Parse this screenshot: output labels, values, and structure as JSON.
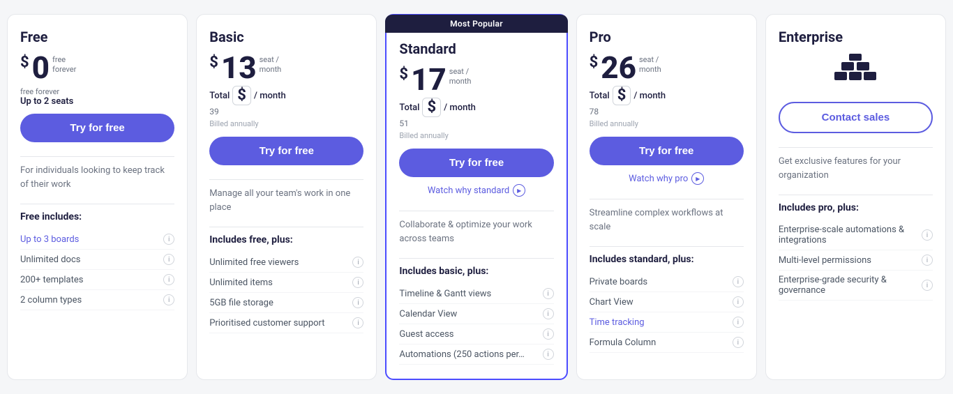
{
  "plans": [
    {
      "id": "free",
      "name": "Free",
      "featured": false,
      "price": "0",
      "price_sublabel1": "free",
      "price_sublabel2": "forever",
      "seats_label": "Up to 2 seats",
      "total_label": null,
      "total_amount": null,
      "billed_label": null,
      "cta_label": "Try for free",
      "cta_style": "primary",
      "watch_label": null,
      "description": "For individuals looking to keep track of their work",
      "includes_title": "Free includes:",
      "features": [
        {
          "text": "Up to 3 boards",
          "link": true
        },
        {
          "text": "Unlimited docs",
          "link": false
        },
        {
          "text": "200+ templates",
          "link": false
        },
        {
          "text": "2 column types",
          "link": false
        }
      ]
    },
    {
      "id": "basic",
      "name": "Basic",
      "featured": false,
      "price": "13",
      "price_sublabel1": "seat /",
      "price_sublabel2": "month",
      "seats_label": null,
      "total_label": "Total",
      "total_amount": "39",
      "billed_label": "Billed annually",
      "cta_label": "Try for free",
      "cta_style": "primary",
      "watch_label": null,
      "description": "Manage all your team's work in one place",
      "includes_title": "Includes free, plus:",
      "features": [
        {
          "text": "Unlimited free viewers",
          "link": false
        },
        {
          "text": "Unlimited items",
          "link": false
        },
        {
          "text": "5GB file storage",
          "link": false
        },
        {
          "text": "Prioritised customer support",
          "link": false
        }
      ]
    },
    {
      "id": "standard",
      "name": "Standard",
      "featured": true,
      "most_popular": "Most Popular",
      "price": "17",
      "price_sublabel1": "seat /",
      "price_sublabel2": "month",
      "seats_label": null,
      "total_label": "Total",
      "total_amount": "51",
      "billed_label": "Billed annually",
      "cta_label": "Try for free",
      "cta_style": "primary",
      "watch_label": "Watch why standard",
      "description": "Collaborate & optimize your work across teams",
      "includes_title": "Includes basic, plus:",
      "features": [
        {
          "text": "Timeline & Gantt views",
          "link": false
        },
        {
          "text": "Calendar View",
          "link": false
        },
        {
          "text": "Guest access",
          "link": false
        },
        {
          "text": "Automations (250 actions per…",
          "link": false
        }
      ]
    },
    {
      "id": "pro",
      "name": "Pro",
      "featured": false,
      "price": "26",
      "price_sublabel1": "seat /",
      "price_sublabel2": "month",
      "seats_label": null,
      "total_label": "Total",
      "total_amount": "78",
      "billed_label": "Billed annually",
      "cta_label": "Try for free",
      "cta_style": "primary",
      "watch_label": "Watch why pro",
      "description": "Streamline complex workflows at scale",
      "includes_title": "Includes standard, plus:",
      "features": [
        {
          "text": "Private boards",
          "link": false
        },
        {
          "text": "Chart View",
          "link": false
        },
        {
          "text": "Time tracking",
          "link": true
        },
        {
          "text": "Formula Column",
          "link": false
        }
      ]
    },
    {
      "id": "enterprise",
      "name": "Enterprise",
      "featured": false,
      "price": null,
      "price_sublabel1": null,
      "price_sublabel2": null,
      "seats_label": null,
      "total_label": null,
      "total_amount": null,
      "billed_label": null,
      "cta_label": "Contact sales",
      "cta_style": "outline",
      "watch_label": null,
      "description": "Get exclusive features for your organization",
      "includes_title": "Includes pro, plus:",
      "features": [
        {
          "text": "Enterprise-scale automations & integrations",
          "link": false
        },
        {
          "text": "Multi-level permissions",
          "link": false
        },
        {
          "text": "Enterprise-grade security & governance",
          "link": false
        }
      ]
    }
  ]
}
